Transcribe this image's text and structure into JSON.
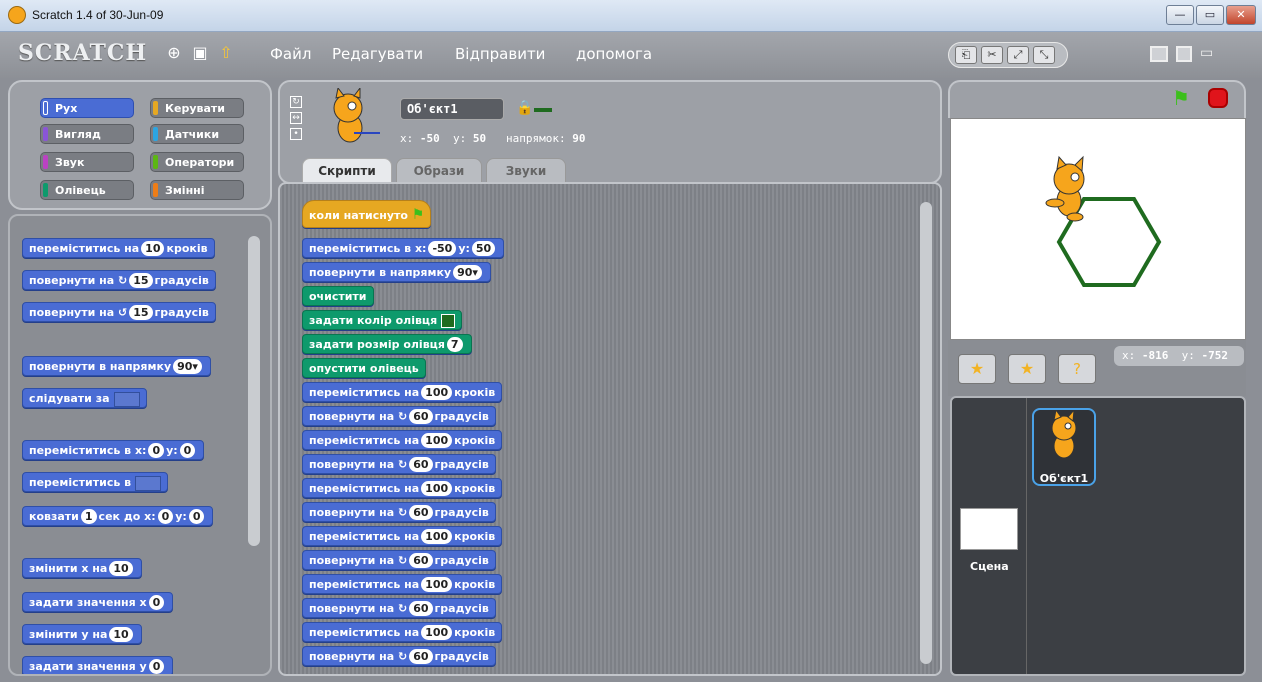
{
  "window": {
    "title": "Scratch 1.4 of 30-Jun-09",
    "min": "—",
    "max": "▭",
    "close": "✕"
  },
  "menu": {
    "logo": "SCRATCH",
    "items": [
      "Файл",
      "Редагувати",
      "Відправити",
      "допомога"
    ]
  },
  "categories": [
    {
      "label": "Рух",
      "color": "#4a6cd4"
    },
    {
      "label": "Керувати",
      "color": "#e6a822"
    },
    {
      "label": "Вигляд",
      "color": "#8a55d7"
    },
    {
      "label": "Датчики",
      "color": "#2ca5e2"
    },
    {
      "label": "Звук",
      "color": "#bb42c3"
    },
    {
      "label": "Оператори",
      "color": "#5cb712"
    },
    {
      "label": "Олівець",
      "color": "#0e9a6c"
    },
    {
      "label": "Змінні",
      "color": "#ee7d16"
    }
  ],
  "palette": {
    "b1": {
      "pre": "переміститись на",
      "n": "10",
      "post": "кроків"
    },
    "b2": {
      "pre": "повернути на ↻",
      "n": "15",
      "post": "градусів"
    },
    "b3": {
      "pre": "повернути на ↺",
      "n": "15",
      "post": "градусів"
    },
    "b4": {
      "pre": "повернути в напрямку",
      "n": "90▾"
    },
    "b5": {
      "pre": "слідувати за"
    },
    "b6": {
      "pre": "переміститись в x:",
      "x": "0",
      "ylbl": "y:",
      "y": "0"
    },
    "b7": {
      "pre": "переміститись в"
    },
    "b8": {
      "pre": "ковзати",
      "n": "1",
      "mid": "сек до x:",
      "x": "0",
      "ylbl": "y:",
      "y": "0"
    },
    "b9": {
      "pre": "змінити x на",
      "n": "10"
    },
    "b10": {
      "pre": "задати значення x",
      "n": "0"
    },
    "b11": {
      "pre": "змінити y на",
      "n": "10"
    },
    "b12": {
      "pre": "задати значення y",
      "n": "0"
    }
  },
  "sprite": {
    "name": "Об'єкт1",
    "x_label": "x:",
    "x": "-50",
    "y_label": "y:",
    "y": "50",
    "dir_label": "напрямок:",
    "dir": "90"
  },
  "tabs": [
    "Скрипти",
    "Образи",
    "Звуки"
  ],
  "script": {
    "hat": "коли натиснуто",
    "goto": {
      "pre": "переміститись в x:",
      "x": "-50",
      "ylbl": "y:",
      "y": "50"
    },
    "point": {
      "pre": "повернути в напрямку",
      "n": "90▾"
    },
    "clear": "очистити",
    "pencolor": "задати колір олівця",
    "pensize": {
      "pre": "задати розмір олівця",
      "n": "7"
    },
    "pendown": "опустити олівець",
    "move": {
      "pre": "переміститись на",
      "n": "100",
      "post": "кроків"
    },
    "turn": {
      "pre": "повернути на ↻",
      "n": "60",
      "post": "градусів"
    }
  },
  "stage": {
    "mouse_x_label": "x:",
    "mouse_x": "-816",
    "mouse_y_label": "y:",
    "mouse_y": "-752",
    "stage_label": "Сцена",
    "sprite_label": "Об'єкт1",
    "pen_color": "#1f6b1f"
  }
}
